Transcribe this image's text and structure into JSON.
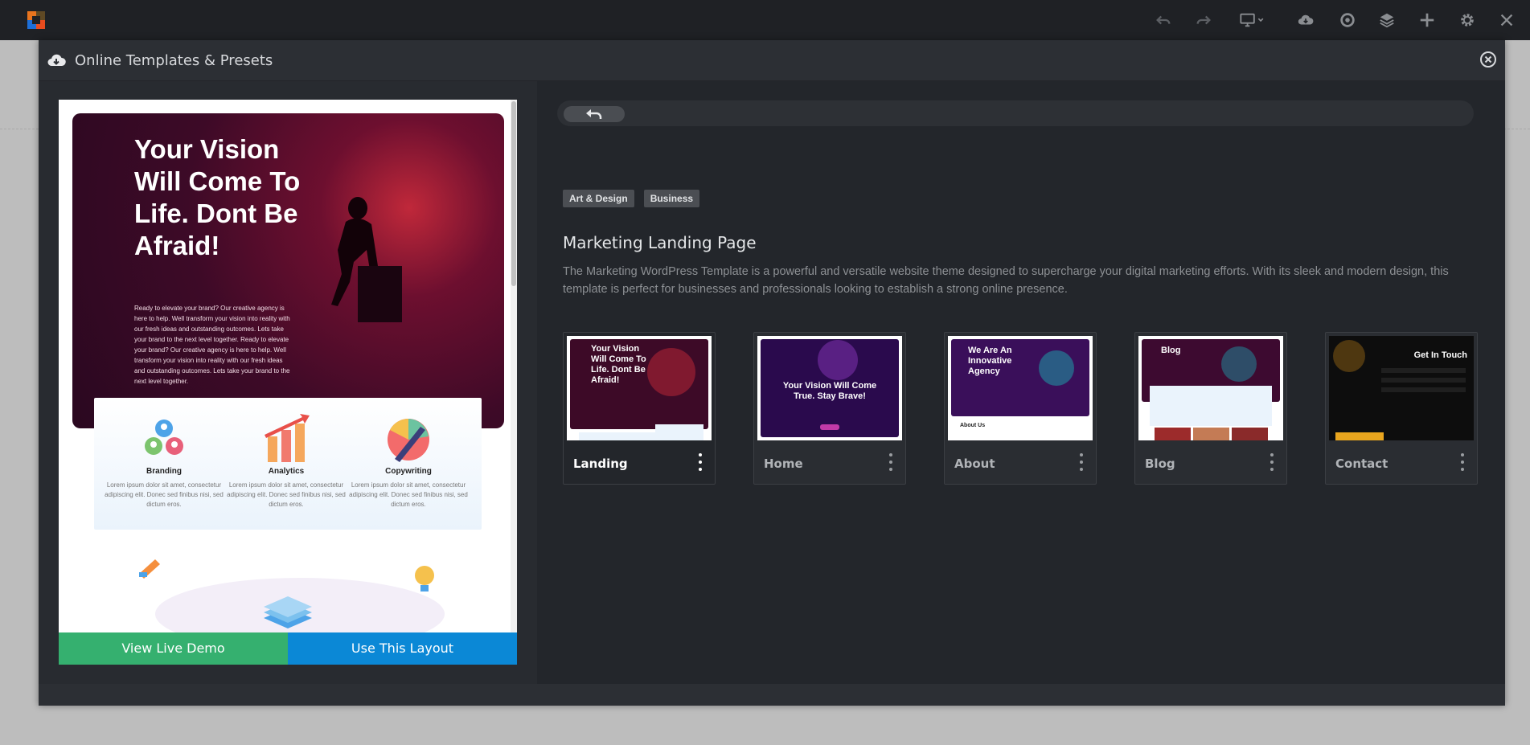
{
  "modal": {
    "title": "Online Templates & Presets"
  },
  "preview": {
    "hero_title": "Your Vision Will Come To Life. Dont Be Afraid!",
    "hero_text": "Ready to elevate your brand? Our creative agency is here to help. Well transform your vision into reality with our fresh ideas and outstanding outcomes. Lets take your brand to the next level together. Ready to elevate your brand? Our creative agency is here to help. Well transform your vision into reality with our fresh ideas and outstanding outcomes. Lets take your brand to the next level together.",
    "features": [
      {
        "title": "Branding",
        "body": "Lorem ipsum dolor sit amet, consectetur adipiscing elit. Donec sed finibus nisi, sed dictum eros."
      },
      {
        "title": "Analytics",
        "body": "Lorem ipsum dolor sit amet, consectetur adipiscing elit. Donec sed finibus nisi, sed dictum eros."
      },
      {
        "title": "Copywriting",
        "body": "Lorem ipsum dolor sit amet, consectetur adipiscing elit. Donec sed finibus nisi, sed dictum eros."
      }
    ],
    "view_demo_label": "View Live Demo",
    "use_layout_label": "Use This Layout"
  },
  "template": {
    "tags": [
      "Art & Design",
      "Business"
    ],
    "title": "Marketing Landing Page",
    "description": "The Marketing WordPress Template is a powerful and versatile website theme designed to supercharge your digital marketing efforts. With its sleek and modern design, this template is perfect for businesses and professionals looking to establish a strong online presence.",
    "pages": [
      {
        "label": "Landing",
        "thumb_title": "Your Vision Will Come To Life. Dont Be Afraid!",
        "active": true
      },
      {
        "label": "Home",
        "thumb_title": "Your Vision Will Come True. Stay Brave!",
        "active": false
      },
      {
        "label": "About",
        "thumb_title": "We Are An Innovative Agency",
        "thumb_sub": "About Us",
        "active": false
      },
      {
        "label": "Blog",
        "thumb_title": "Blog",
        "active": false
      },
      {
        "label": "Contact",
        "thumb_title": "Get In Touch",
        "active": false
      }
    ]
  },
  "colors": {
    "topbar": "#1f2125",
    "modal": "#282b30",
    "demo_button": "#35b06f",
    "use_button": "#0b88d6"
  },
  "icons": {
    "toolbar": [
      "undo-icon",
      "redo-icon",
      "desktop-icon",
      "cloud-download-icon",
      "settings-circle-icon",
      "layers-icon",
      "plus-icon",
      "gear-icon",
      "close-icon"
    ]
  }
}
